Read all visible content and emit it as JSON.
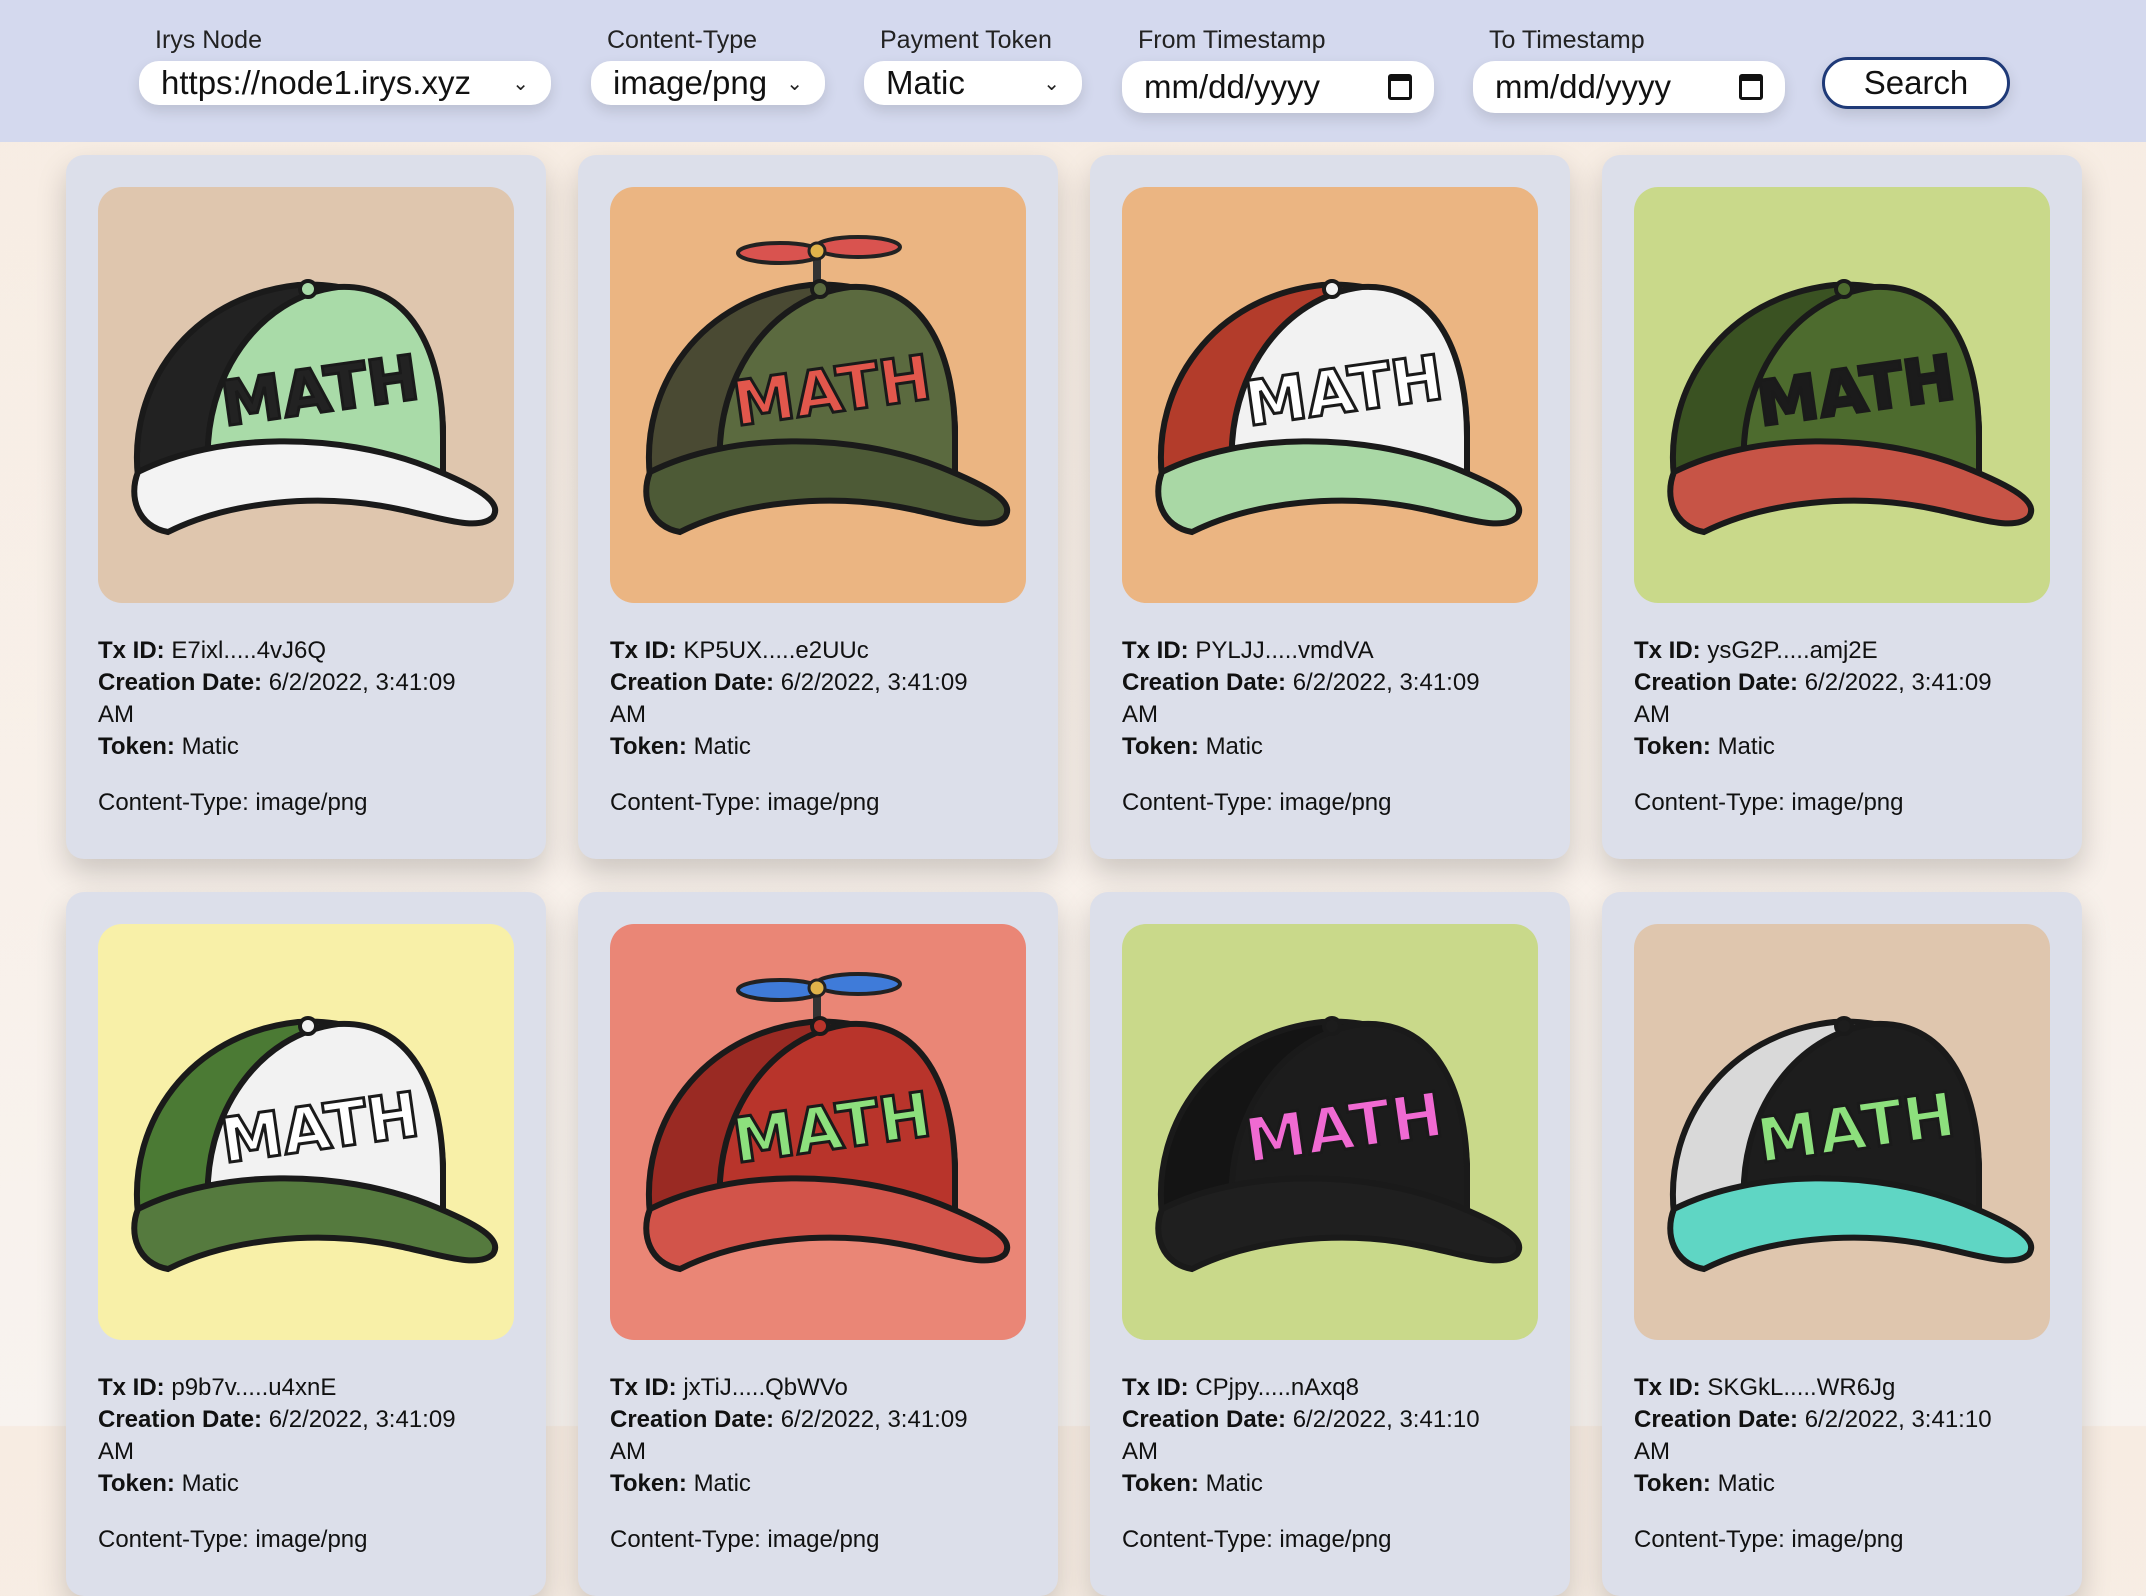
{
  "filters": {
    "node": {
      "label": "Irys Node",
      "value": "https://node1.irys.xyz"
    },
    "content_type": {
      "label": "Content-Type",
      "value": "image/png"
    },
    "payment_token": {
      "label": "Payment Token",
      "value": "Matic"
    },
    "from": {
      "label": "From Timestamp",
      "value": "mm/dd/yyyy"
    },
    "to": {
      "label": "To Timestamp",
      "value": "mm/dd/yyyy"
    },
    "search_label": "Search"
  },
  "labels": {
    "tx_id": "Tx ID:",
    "creation_date": "Creation Date:",
    "token": "Token:",
    "content_type": "Content-Type: "
  },
  "cards": [
    {
      "tx_id": "E7ixl.....4vJ6Q",
      "date_line1": "6/2/2022, 3:41:09",
      "date_line2": "AM",
      "token": "Matic",
      "content_type": "image/png",
      "bg": "#dfc6ae",
      "crown": "#a9dba8",
      "back": "#222222",
      "brim": "#f3f3f3",
      "text": "#222222",
      "propeller": false
    },
    {
      "tx_id": "KP5UX.....e2UUc",
      "date_line1": "6/2/2022, 3:41:09",
      "date_line2": "AM",
      "token": "Matic",
      "content_type": "image/png",
      "bg": "#ebb582",
      "crown": "#5b6a3f",
      "back": "#4a4a33",
      "brim": "#4d5a36",
      "text": "#e2574c",
      "propeller": true,
      "prop_color": "#d9534f"
    },
    {
      "tx_id": "PYLJJ.....vmdVA",
      "date_line1": "6/2/2022, 3:41:09",
      "date_line2": "AM",
      "token": "Matic",
      "content_type": "image/png",
      "bg": "#ebb582",
      "crown": "#f2f2f2",
      "back": "#b33c2b",
      "brim": "#a9d8a5",
      "text": "#ffffff",
      "propeller": false
    },
    {
      "tx_id": "ysG2P.....amj2E",
      "date_line1": "6/2/2022, 3:41:09",
      "date_line2": "AM",
      "token": "Matic",
      "content_type": "image/png",
      "bg": "#c9d98a",
      "crown": "#4d6b2e",
      "back": "#3a5222",
      "brim": "#c75446",
      "text": "#1b1b1b",
      "propeller": false
    },
    {
      "tx_id": "p9b7v.....u4xnE",
      "date_line1": "6/2/2022, 3:41:09",
      "date_line2": "AM",
      "token": "Matic",
      "content_type": "image/png",
      "bg": "#f8f0a8",
      "crown": "#f2f2f2",
      "back": "#4b7a34",
      "brim": "#557a3e",
      "text": "#ffffff",
      "propeller": false
    },
    {
      "tx_id": "jxTiJ.....QbWVo",
      "date_line1": "6/2/2022, 3:41:09",
      "date_line2": "AM",
      "token": "Matic",
      "content_type": "image/png",
      "bg": "#ea8676",
      "crown": "#b8342b",
      "back": "#9a2a23",
      "brim": "#d2544a",
      "text": "#8de07d",
      "propeller": true,
      "prop_color": "#3f7bd9"
    },
    {
      "tx_id": "CPjpy.....nAxq8",
      "date_line1": "6/2/2022, 3:41:10",
      "date_line2": "AM",
      "token": "Matic",
      "content_type": "image/png",
      "bg": "#c9d98a",
      "crown": "#1c1c1c",
      "back": "#141414",
      "brim": "#1f1f1f",
      "text": "#f06ad2",
      "propeller": false
    },
    {
      "tx_id": "SKGkL.....WR6Jg",
      "date_line1": "6/2/2022, 3:41:10",
      "date_line2": "AM",
      "token": "Matic",
      "content_type": "image/png",
      "bg": "#dfc6ae",
      "crown": "#1d1d1d",
      "back": "#d9d9d9",
      "brim": "#5fd6c4",
      "text": "#8de07d",
      "propeller": false
    }
  ],
  "hat_text": "MATH"
}
